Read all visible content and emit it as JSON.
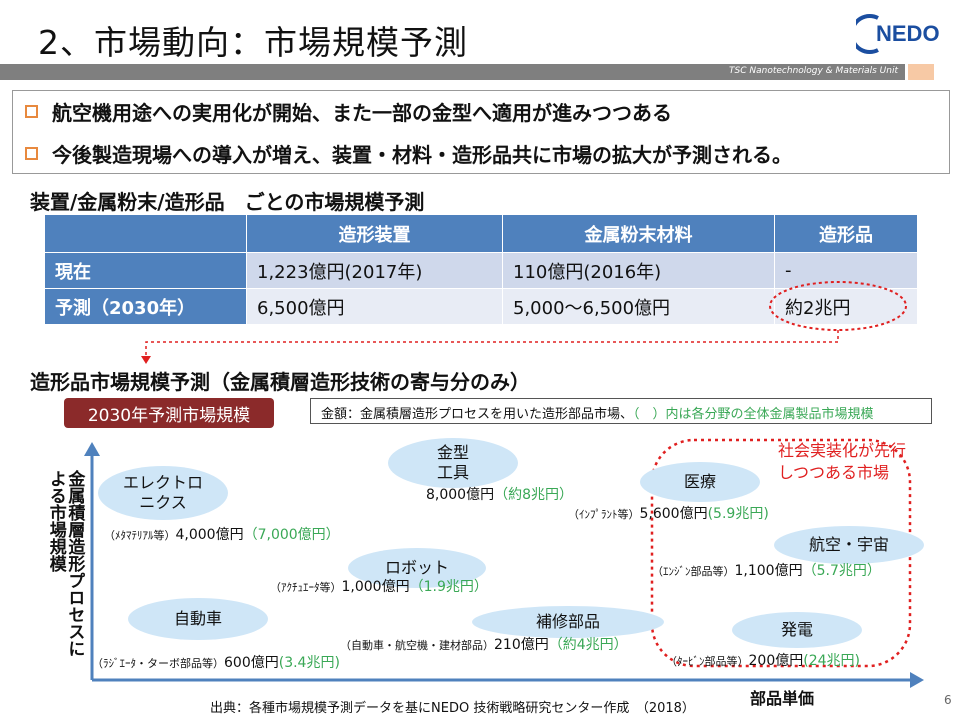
{
  "title": "2、市場動向：市場規模予測",
  "logo_text": "NEDO",
  "header_unit": "TSC  Nanotechnology & Materials Unit",
  "bullets": [
    "航空機用途への実用化が開始、また一部の金型へ適用が進みつつある",
    "今後製造現場への導入が増え、装置・材料・造形品共に市場の拡大が予測される。"
  ],
  "table_section": {
    "heading": "装置/金属粉末/造形品　ごとの市場規模予測",
    "columns": [
      "",
      "造形装置",
      "金属粉末材料",
      "造形品"
    ],
    "rows": [
      [
        "現在",
        "1,223億円(2017年)",
        "110億円(2016年)",
        "-"
      ],
      [
        "予測（2030年）",
        "6,500億円",
        "5,000～6,500億円",
        "約2兆円"
      ]
    ]
  },
  "market_section": {
    "heading": "造形品市場規模予測（金属積層造形技術の寄与分のみ）",
    "badge": "2030年予測市場規模",
    "note_prefix": "金額：金属積層造形プロセスを用いた造形部品市場、",
    "note_green": "（　）内は各分野の全体金属製品市場規模",
    "y_axis_label": "金属積層造形プロセスによる市場規模",
    "x_axis_label": "部品単価",
    "callout": "社会実装化が先行\nしつつある市場",
    "segments": [
      {
        "name": "エレクトロ\nニクス",
        "detail": "（ﾒﾀﾏﾃﾘｱﾙ等）",
        "value": "4,000億円",
        "total": "（7,000億円）"
      },
      {
        "name": "金型\n工具",
        "detail": "",
        "value": "8,000億円",
        "total": "（約8兆円）"
      },
      {
        "name": "医療",
        "detail": "（ｲﾝﾌﾟﾗﾝﾄ等）",
        "value": "5,600億円",
        "total": "(5.9兆円)"
      },
      {
        "name": "ロボット",
        "detail": "（ｱｸﾁｭｴｰﾀ等）",
        "value": "1,000億円",
        "total": "（1.9兆円）"
      },
      {
        "name": "航空・宇宙",
        "detail": "（ｴﾝｼﾞﾝ部品等）",
        "value": "1,100億円",
        "total": "（5.7兆円）"
      },
      {
        "name": "自動車",
        "detail": "（ﾗｼﾞｴｰﾀ・ターボ部品等）",
        "value": "600億円",
        "total": "(3.4兆円)"
      },
      {
        "name": "補修部品",
        "detail": "（自動車・航空機・建材部品）",
        "value": "210億円",
        "total": "（約4兆円）"
      },
      {
        "name": "発電",
        "detail": "（ﾀｰﾋﾞﾝ部品等）",
        "value": "200億円",
        "total": "(24兆円)"
      }
    ]
  },
  "source": "出典：各種市場規模予測データを基にNEDO 技術戦略研究センター作成　（2018）",
  "page_number": "6",
  "colors": {
    "table_header": "#4f81bd",
    "badge": "#8b2a2a",
    "ellipse": "#cfe6f7",
    "green_total": "#3aa856",
    "callout_red": "#e02020",
    "bullet_square": "#e8893e"
  }
}
